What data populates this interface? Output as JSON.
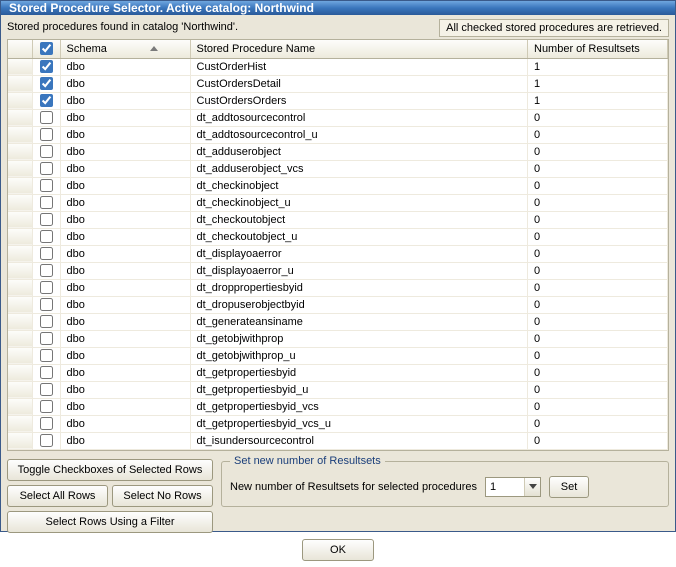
{
  "title": "Stored Procedure Selector. Active catalog: Northwind",
  "info": {
    "found_text": "Stored procedures found in catalog 'Northwind'.",
    "retrieved_text": "All checked stored procedures are retrieved."
  },
  "grid": {
    "headers": {
      "schema": "Schema",
      "name": "Stored Procedure Name",
      "results": "Number of Resultsets"
    },
    "rows": [
      {
        "checked": true,
        "schema": "dbo",
        "name": "CustOrderHist",
        "results": "1"
      },
      {
        "checked": true,
        "schema": "dbo",
        "name": "CustOrdersDetail",
        "results": "1"
      },
      {
        "checked": true,
        "schema": "dbo",
        "name": "CustOrdersOrders",
        "results": "1"
      },
      {
        "checked": false,
        "schema": "dbo",
        "name": "dt_addtosourcecontrol",
        "results": "0"
      },
      {
        "checked": false,
        "schema": "dbo",
        "name": "dt_addtosourcecontrol_u",
        "results": "0"
      },
      {
        "checked": false,
        "schema": "dbo",
        "name": "dt_adduserobject",
        "results": "0"
      },
      {
        "checked": false,
        "schema": "dbo",
        "name": "dt_adduserobject_vcs",
        "results": "0"
      },
      {
        "checked": false,
        "schema": "dbo",
        "name": "dt_checkinobject",
        "results": "0"
      },
      {
        "checked": false,
        "schema": "dbo",
        "name": "dt_checkinobject_u",
        "results": "0"
      },
      {
        "checked": false,
        "schema": "dbo",
        "name": "dt_checkoutobject",
        "results": "0"
      },
      {
        "checked": false,
        "schema": "dbo",
        "name": "dt_checkoutobject_u",
        "results": "0"
      },
      {
        "checked": false,
        "schema": "dbo",
        "name": "dt_displayoaerror",
        "results": "0"
      },
      {
        "checked": false,
        "schema": "dbo",
        "name": "dt_displayoaerror_u",
        "results": "0"
      },
      {
        "checked": false,
        "schema": "dbo",
        "name": "dt_droppropertiesbyid",
        "results": "0"
      },
      {
        "checked": false,
        "schema": "dbo",
        "name": "dt_dropuserobjectbyid",
        "results": "0"
      },
      {
        "checked": false,
        "schema": "dbo",
        "name": "dt_generateansiname",
        "results": "0"
      },
      {
        "checked": false,
        "schema": "dbo",
        "name": "dt_getobjwithprop",
        "results": "0"
      },
      {
        "checked": false,
        "schema": "dbo",
        "name": "dt_getobjwithprop_u",
        "results": "0"
      },
      {
        "checked": false,
        "schema": "dbo",
        "name": "dt_getpropertiesbyid",
        "results": "0"
      },
      {
        "checked": false,
        "schema": "dbo",
        "name": "dt_getpropertiesbyid_u",
        "results": "0"
      },
      {
        "checked": false,
        "schema": "dbo",
        "name": "dt_getpropertiesbyid_vcs",
        "results": "0"
      },
      {
        "checked": false,
        "schema": "dbo",
        "name": "dt_getpropertiesbyid_vcs_u",
        "results": "0"
      },
      {
        "checked": false,
        "schema": "dbo",
        "name": "dt_isundersourcecontrol",
        "results": "0"
      }
    ]
  },
  "buttons": {
    "toggle": "Toggle Checkboxes of Selected Rows",
    "select_all": "Select All Rows",
    "select_none": "Select No Rows",
    "select_filter": "Select Rows Using a Filter",
    "set": "Set",
    "ok": "OK"
  },
  "resultsets_box": {
    "legend": "Set new number of Resultsets",
    "label": "New number of Resultsets for selected procedures",
    "value": "1"
  }
}
